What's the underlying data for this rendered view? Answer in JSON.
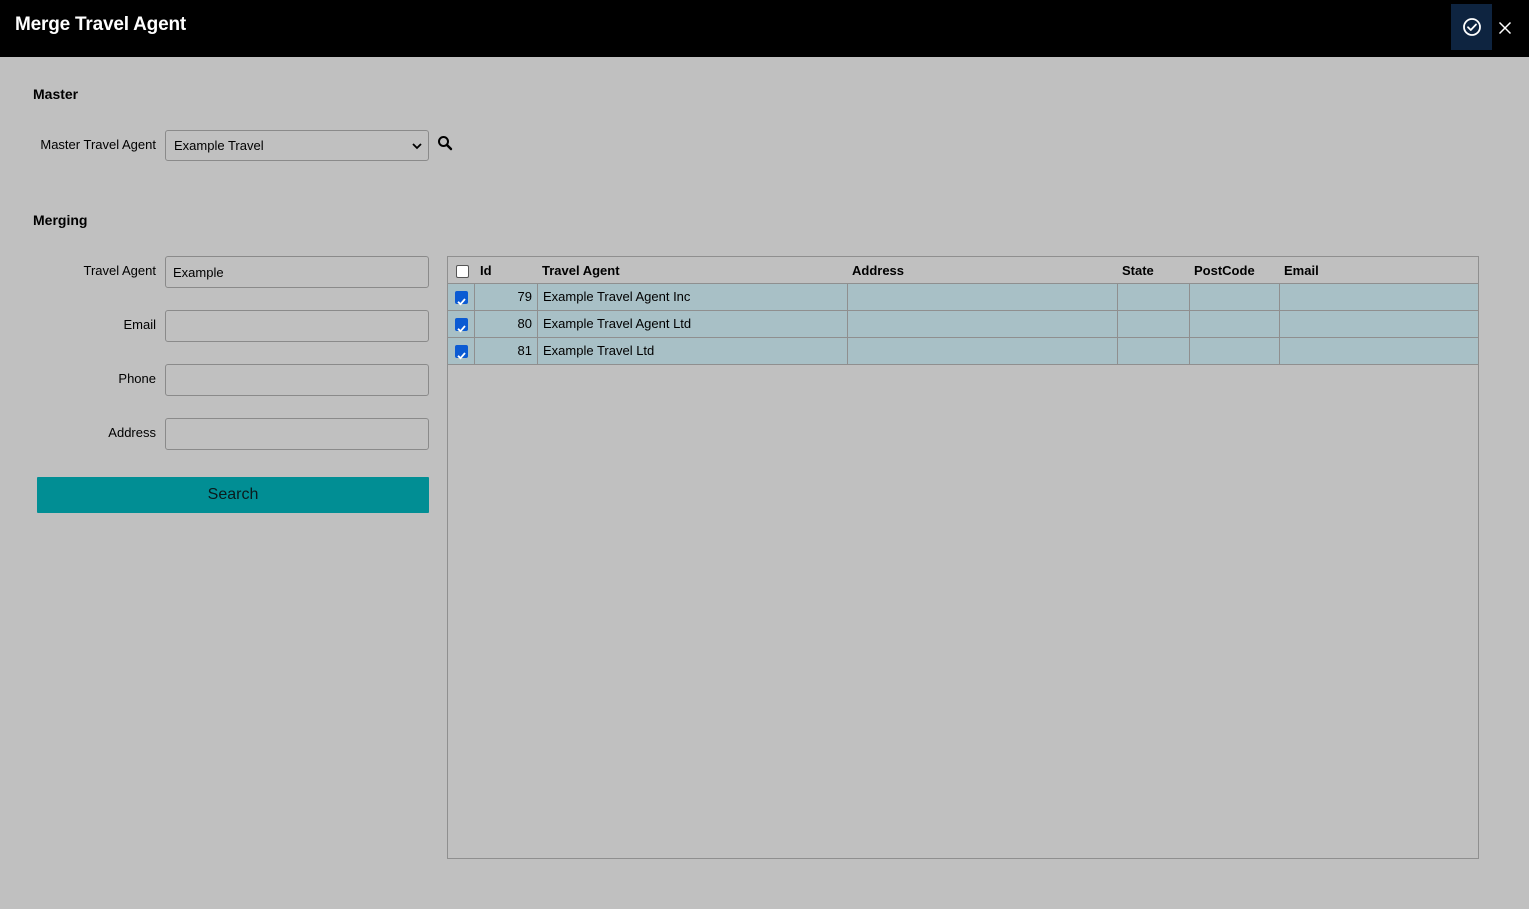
{
  "window": {
    "title": "Merge Travel Agent"
  },
  "master": {
    "section_title": "Master",
    "agent_label": "Master Travel Agent",
    "agent_value": "Example Travel"
  },
  "merging": {
    "section_title": "Merging",
    "fields": {
      "travel_agent_label": "Travel Agent",
      "travel_agent_value": "Example",
      "email_label": "Email",
      "email_value": "",
      "phone_label": "Phone",
      "phone_value": "",
      "address_label": "Address",
      "address_value": ""
    },
    "search_label": "Search"
  },
  "table": {
    "columns": [
      "Id",
      "Travel Agent",
      "Address",
      "State",
      "PostCode",
      "Email"
    ],
    "rows": [
      {
        "checked": true,
        "id": "79",
        "travel_agent": "Example Travel Agent Inc",
        "address": "",
        "state": "",
        "postcode": "",
        "email": ""
      },
      {
        "checked": true,
        "id": "80",
        "travel_agent": "Example Travel Agent Ltd",
        "address": "",
        "state": "",
        "postcode": "",
        "email": ""
      },
      {
        "checked": true,
        "id": "81",
        "travel_agent": "Example Travel Ltd",
        "address": "",
        "state": "",
        "postcode": "",
        "email": ""
      }
    ]
  },
  "colors": {
    "titlebar": "#000000",
    "background": "#c0c0c0",
    "accent": "#018e94",
    "row_selected": "#a8c0c6",
    "checkbox": "#0b5bd3"
  },
  "icons": {
    "confirm": "check-circle-icon",
    "close": "close-icon",
    "lookup": "search-icon",
    "dropdown": "chevron-down-icon"
  }
}
